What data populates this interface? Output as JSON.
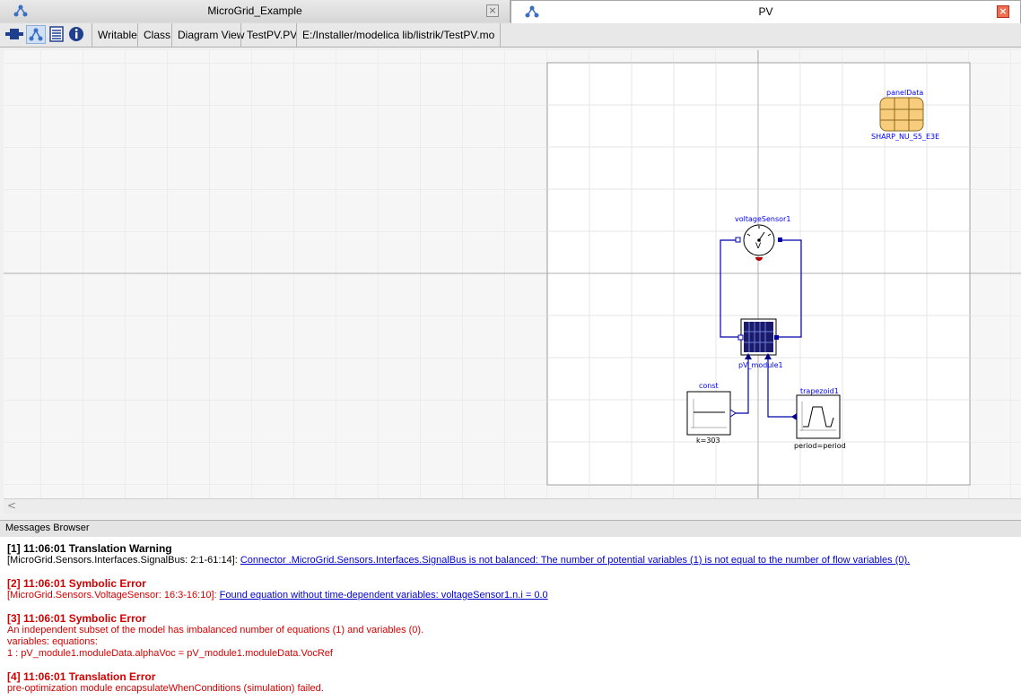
{
  "tabs": [
    {
      "label": "MicroGrid_Example",
      "close": "×"
    },
    {
      "label": "PV",
      "close": "×"
    }
  ],
  "toolbar": {
    "writable": "Writable",
    "class": "Class",
    "view": "Diagram View",
    "model": "TestPV.PV",
    "path": "E:/Installer/modelica lib/listrik/TestPV.mo"
  },
  "diagram": {
    "panel_data_label": "panelData",
    "panel_data_sub": "SHARP_NU_S5_E3E",
    "voltage_sensor_label": "voltageSensor1",
    "voltage_sensor_symbol": "V",
    "pv_module_label": "pV_module1",
    "const_label": "const",
    "const_param": "k=303",
    "trapezoid_label": "trapezoid1",
    "trapezoid_param": "period=period"
  },
  "messages_browser": {
    "title": "Messages Browser",
    "items": [
      {
        "head": "[1] 11:06:01 Translation Warning",
        "source": "[MicroGrid.Sensors.Interfaces.SignalBus: 2:1-61:14]:",
        "link": "Connector .MicroGrid.Sensors.Interfaces.SignalBus is not balanced: The number of potential variables (1) is not equal to the number of flow variables (0)."
      },
      {
        "head": "[2] 11:06:01 Symbolic Error",
        "source": "[MicroGrid.Sensors.VoltageSensor: 16:3-16:10]:",
        "link": "Found equation without time-dependent variables: voltageSensor1.n.i = 0.0"
      },
      {
        "head": "[3] 11:06:01 Symbolic Error",
        "line1": "An independent subset of the model has imbalanced number of equations (1) and variables (0).",
        "line2": "variables: equations:",
        "line3": "1 : pV_module1.moduleData.alphaVoc = pV_module1.moduleData.VocRef"
      },
      {
        "head": "[4] 11:06:01 Translation Error",
        "line1": "pre-optimization module encapsulateWhenConditions (simulation) failed."
      }
    ]
  },
  "colors": {
    "wire": "#0000aa",
    "label": "#0000ff",
    "error": "#d40000",
    "link": "#0000cc"
  }
}
